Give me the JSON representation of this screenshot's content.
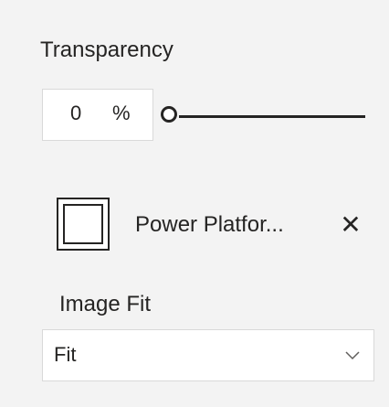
{
  "transparency": {
    "label": "Transparency",
    "value": "0",
    "unit": "%",
    "slider_level": 0
  },
  "image": {
    "name": "Power Platfor...",
    "close_glyph": "✕"
  },
  "image_fit": {
    "label": "Image Fit",
    "selected": "Fit"
  },
  "colors": {
    "background": "#f3f3f3",
    "text": "#252423",
    "border": "#d9d9d9"
  }
}
